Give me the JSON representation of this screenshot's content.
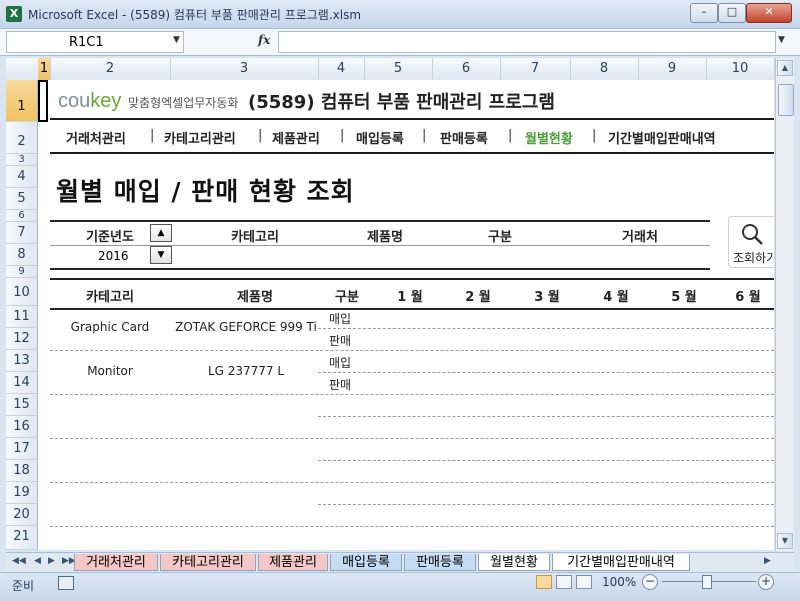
{
  "window": {
    "app_icon": "excel-icon",
    "title": "Microsoft Excel - (5589) 컴퓨터 부품 판매관리 프로그램.xlsm",
    "minimize": "–",
    "maximize": "□",
    "close": "✕"
  },
  "formula_bar": {
    "name_box": "R1C1",
    "fx": "fx",
    "formula": ""
  },
  "columns": [
    "1",
    "2",
    "3",
    "4",
    "5",
    "6",
    "7",
    "8",
    "9",
    "10"
  ],
  "rows": [
    "1",
    "2",
    "3",
    "4",
    "5",
    "6",
    "7",
    "8",
    "9",
    "10",
    "11",
    "12",
    "13",
    "14",
    "15",
    "16",
    "17",
    "18",
    "19",
    "20",
    "21"
  ],
  "header": {
    "logo_cou": "cou",
    "logo_key": "key",
    "logo_tagline": "맞춤형엑셀업무자동화",
    "title": "(5589) 컴퓨터 부품 판매관리 프로그램"
  },
  "nav": {
    "items": [
      "거래처관리",
      "카테고리관리",
      "제품관리",
      "매입등록",
      "판매등록",
      "월별현황",
      "기간별매입판매내역"
    ],
    "active": "월별현황",
    "separator": "|"
  },
  "section_title": "월별 매입 / 판매 현황 조회",
  "filters": {
    "labels": [
      "기준년도",
      "카테고리",
      "제품명",
      "구분",
      "거래처"
    ],
    "year_value": "2016",
    "spin_up": "▲",
    "spin_down": "▼"
  },
  "search_button": {
    "icon": "magnifier-icon",
    "label": "조회하기"
  },
  "table": {
    "headers": [
      "카테고리",
      "제품명",
      "구분",
      "1 월",
      "2 월",
      "3 월",
      "4 월",
      "5 월",
      "6 월"
    ],
    "rows": [
      {
        "category": "Graphic Card",
        "product": "ZOTAK GEFORCE 999 Ti",
        "types": [
          "매입",
          "판매"
        ]
      },
      {
        "category": "Monitor",
        "product": "LG 237777 L",
        "types": [
          "매입",
          "판매"
        ]
      }
    ]
  },
  "sheet_tabs": {
    "tabs": [
      "거래처관리",
      "카테고리관리",
      "제품관리",
      "매입등록",
      "판매등록",
      "월별현황",
      "기간별매입판매내역"
    ],
    "active": "월별현황",
    "tab_colors": [
      "#f4c6c6",
      "#f4c6c6",
      "#f4c6c6",
      "#c6dcf4",
      "#c6dcf4",
      "#ffffff",
      "#ffffff"
    ]
  },
  "status_bar": {
    "ready": "준비",
    "zoom": "100%",
    "zoom_out": "−",
    "zoom_in": "+"
  }
}
